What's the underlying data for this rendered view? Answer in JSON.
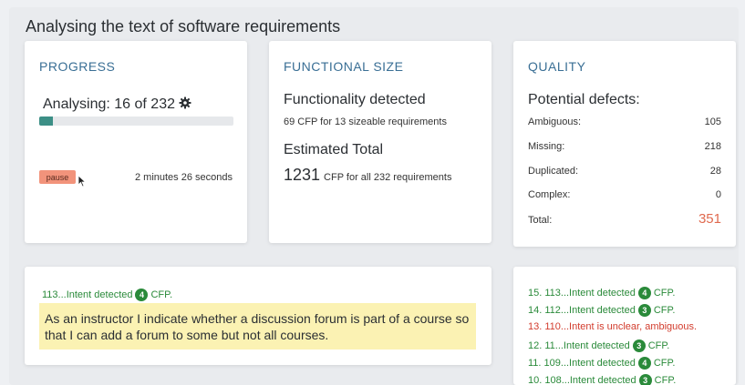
{
  "page": {
    "title": "Analysing the text of software requirements"
  },
  "progress": {
    "heading": "PROGRESS",
    "status": "Analysing: 16 of 232",
    "fraction": 0.069,
    "pause_label": "pause",
    "elapsed": "2 minutes 26 seconds"
  },
  "functional_size": {
    "heading": "FUNCTIONAL SIZE",
    "detected_title": "Functionality detected",
    "detected_line": "69  CFP for 13  sizeable requirements",
    "estimated_title": "Estimated Total",
    "total_value": "1231",
    "total_suffix": "CFP for all 232 requirements"
  },
  "quality": {
    "heading": "QUALITY",
    "subtitle": "Potential defects:",
    "rows": [
      {
        "label": "Ambiguous:",
        "value": "105"
      },
      {
        "label": "Missing:",
        "value": "218"
      },
      {
        "label": "Duplicated:",
        "value": "28"
      },
      {
        "label": "Complex:",
        "value": "0"
      }
    ],
    "total_label": "Total:",
    "total_value": "351",
    "total_color": "#e06a4f"
  },
  "intent": {
    "head_text": "113...Intent detected",
    "head_count": "4",
    "head_suffix": "CFP.",
    "story": "As an instructor I indicate whether a discussion forum is part of a course so that I can add a forum to some but not all courses.",
    "highlight_color": "#fbf2b3"
  },
  "log": [
    {
      "text": "15. 113...Intent detected",
      "count": "4",
      "suffix": "CFP.",
      "status": "ok"
    },
    {
      "text": "14. 112...Intent detected",
      "count": "3",
      "suffix": "CFP.",
      "status": "ok"
    },
    {
      "text": "13. 110...Intent is unclear, ambiguous.",
      "count": "",
      "suffix": "",
      "status": "warn"
    },
    {
      "text": "12. 11...Intent detected",
      "count": "3",
      "suffix": "CFP.",
      "status": "ok"
    },
    {
      "text": "11. 109...Intent detected",
      "count": "4",
      "suffix": "CFP.",
      "status": "ok"
    },
    {
      "text": "10. 108...Intent detected",
      "count": "3",
      "suffix": "CFP.",
      "status": "ok"
    }
  ],
  "colors": {
    "accent": "#3a6f95",
    "success": "#2a8a3a",
    "danger": "#d23c2d",
    "pause": "#f2937b"
  },
  "icons": {
    "settings": "gear-icon",
    "pointer": "cursor-icon"
  }
}
